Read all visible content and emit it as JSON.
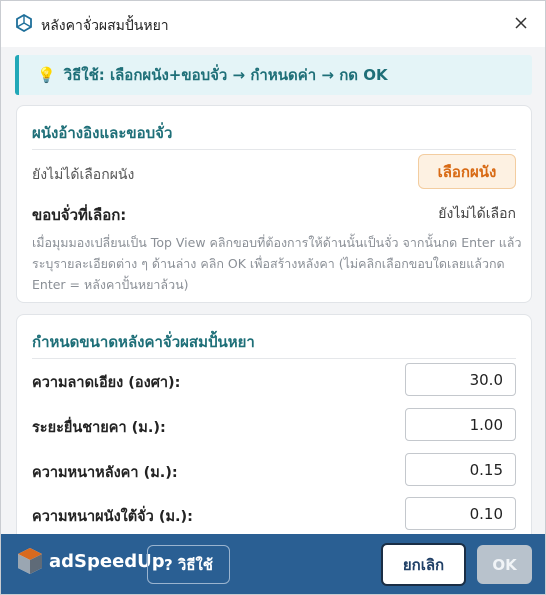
{
  "window": {
    "title": "หลังคาจั่วผสมปั้นหยา"
  },
  "tip": {
    "icon": "lightbulb-icon",
    "text": "วิธีใช้: เลือกผนัง+ขอบจั่ว → กำหนดค่า → กด OK"
  },
  "reference": {
    "title": "ผนังอ้างอิงและขอบจั่ว",
    "wall_status": "ยังไม่ได้เลือกผนัง",
    "select_wall_button": "เลือกผนัง",
    "gable_label": "ขอบจั่วที่เลือก:",
    "gable_value": "ยังไม่ได้เลือก",
    "instructions": "เมื่อมุมมองเปลี่ยนเป็น Top View คลิกขอบที่ต้องการให้ด้านนั้นเป็นจั่ว จากนั้นกด Enter แล้วระบุรายละเอียดต่าง ๆ ด้านล่าง คลิก OK เพื่อสร้างหลังคา (ไม่คลิกเลือกขอบใดเลยแล้วกด Enter = หลังคาปั้นหยาล้วน)"
  },
  "dimensions": {
    "title": "กำหนดขนาดหลังคาจั่วผสมปั้นหยา",
    "fields": [
      {
        "label": "ความลาดเอียง (องศา):",
        "value": "30.0"
      },
      {
        "label": "ระยะยื่นชายคา (ม.):",
        "value": "1.00"
      },
      {
        "label": "ความหนาหลังคา (ม.):",
        "value": "0.15"
      },
      {
        "label": "ความหนาผนังใต้จั่ว (ม.):",
        "value": "0.10"
      }
    ]
  },
  "footer": {
    "brand": "adSpeedUp",
    "help_button": "? วิธีใช้",
    "cancel_button": "ยกเลิก",
    "ok_button": "OK"
  },
  "colors": {
    "accent": "#1e6f78",
    "footer_bg": "#2a5f93",
    "orange_button": "#d86a14"
  }
}
